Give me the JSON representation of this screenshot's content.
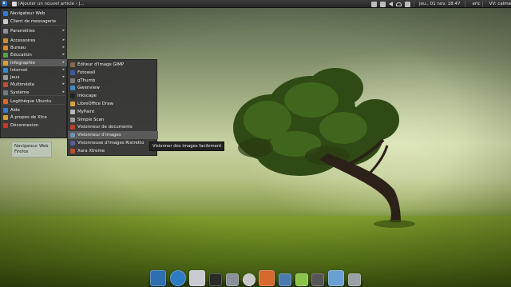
{
  "top_panel": {
    "task_title": "[Ajouter un nouvel article ‹ J...",
    "clock": "jeu., 01 nov. 18:47",
    "user": "eric",
    "weather": "VV: calme"
  },
  "main_menu": {
    "items": [
      {
        "label": "Navigateur Web",
        "icon": "web-browser-icon",
        "color": "#3a78c9"
      },
      {
        "label": "Client de messagerie",
        "icon": "mail-client-icon",
        "color": "#c9c9c9"
      },
      {
        "label": "Paramètres",
        "icon": "settings-icon",
        "color": "#8a8f99"
      },
      {
        "label": "Accessoires",
        "icon": "accessories-icon",
        "color": "#c98d3a"
      },
      {
        "label": "Bureau",
        "icon": "office-icon",
        "color": "#d98a2e"
      },
      {
        "label": "Éducation",
        "icon": "education-icon",
        "color": "#5aa04a"
      },
      {
        "label": "Infographie",
        "icon": "graphics-icon",
        "color": "#d7a23a"
      },
      {
        "label": "Internet",
        "icon": "internet-icon",
        "color": "#3b8ad1"
      },
      {
        "label": "Jeux",
        "icon": "games-icon",
        "color": "#9b9b9b"
      },
      {
        "label": "Multimédia",
        "icon": "multimedia-icon",
        "color": "#c44b3a"
      },
      {
        "label": "Système",
        "icon": "system-icon",
        "color": "#707a86"
      },
      {
        "label": "Logithèque Ubuntu",
        "icon": "software-center-icon",
        "color": "#d9682e"
      },
      {
        "label": "Aide",
        "icon": "help-icon",
        "color": "#3a7bd1"
      },
      {
        "label": "À propos de Xfce",
        "icon": "about-xfce-icon",
        "color": "#d0a23a"
      },
      {
        "label": "Déconnexion",
        "icon": "logout-icon",
        "color": "#c03a2e"
      }
    ]
  },
  "submenu": {
    "items": [
      {
        "label": "Éditeur d'image GIMP",
        "icon": "gimp-icon",
        "color": "#8a6a4a"
      },
      {
        "label": "Fotowall",
        "icon": "fotowall-icon",
        "color": "#3a5aa8"
      },
      {
        "label": "gThumb",
        "icon": "gthumb-icon",
        "color": "#7a7a7a"
      },
      {
        "label": "Gwenview",
        "icon": "gwenview-icon",
        "color": "#3a8ac9"
      },
      {
        "label": "Inkscape",
        "icon": "inkscape-icon",
        "color": "#222222"
      },
      {
        "label": "LibreOffice Draw",
        "icon": "libreoffice-draw-icon",
        "color": "#d9a52e"
      },
      {
        "label": "MyPaint",
        "icon": "mypaint-icon",
        "color": "#b8b8b8"
      },
      {
        "label": "Simple Scan",
        "icon": "simple-scan-icon",
        "color": "#9a9a9a"
      },
      {
        "label": "Visionneur de documents",
        "icon": "document-viewer-icon",
        "color": "#c23a2a"
      },
      {
        "label": "Visionneur d'images",
        "icon": "image-viewer-icon",
        "color": "#6e8fb8"
      },
      {
        "label": "Visionneuse d'images Ristretto",
        "icon": "ristretto-icon",
        "color": "#5a5a9a"
      },
      {
        "label": "Xara Xtreme",
        "icon": "xara-xtreme-icon",
        "color": "#c84a2a"
      }
    ]
  },
  "tooltips": {
    "image_viewer": "Visionner des images facilement",
    "web_browser": "Navigateur Web\nFirefox"
  },
  "dock": {
    "items": [
      {
        "name": "desktop-icon",
        "color": "#2f6fb0"
      },
      {
        "name": "web-browser-icon",
        "color": "#2e7bc4"
      },
      {
        "name": "mail-icon",
        "color": "#c8ccd2"
      },
      {
        "name": "terminal-icon",
        "color": "#2a2a2a"
      },
      {
        "name": "settings-tools-icon",
        "color": "#8a8f99"
      },
      {
        "name": "search-icon",
        "color": "#c7c7c7"
      },
      {
        "name": "software-center-icon",
        "color": "#d9682e"
      },
      {
        "name": "text-editor-icon",
        "color": "#4a7ab0"
      },
      {
        "name": "music-player-icon",
        "color": "#8bc34a"
      },
      {
        "name": "games-icon",
        "color": "#555555"
      },
      {
        "name": "file-manager-icon",
        "color": "#6a9fd4"
      },
      {
        "name": "trash-icon",
        "color": "#9aa0a6"
      }
    ]
  }
}
